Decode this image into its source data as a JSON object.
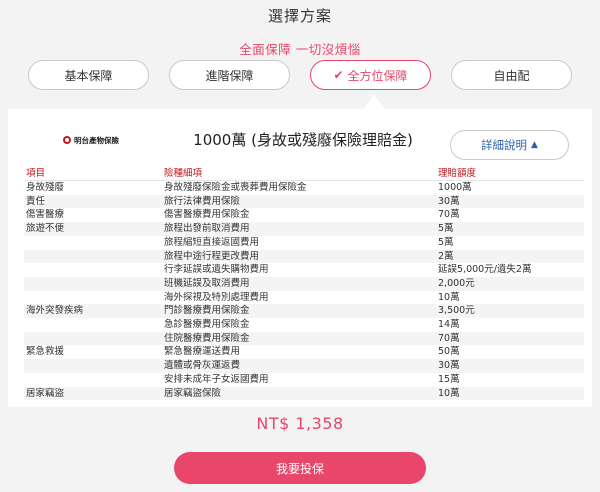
{
  "page": {
    "title": "選擇方案",
    "subtitle": "全面保障 一切沒煩惱"
  },
  "plans": [
    {
      "label": "基本保障",
      "active": false
    },
    {
      "label": "進階保障",
      "active": false
    },
    {
      "label": "全方位保障",
      "active": true
    },
    {
      "label": "自由配",
      "active": false
    }
  ],
  "insurer": {
    "logo_text": "明台產物保險"
  },
  "coverage": {
    "title": "1000萬 (身故或殘廢保險理賠金)",
    "details_label": "詳細說明",
    "headers": [
      "項目",
      "險種細項",
      "理賠額度"
    ],
    "rows": [
      [
        "身故殘廢",
        "身故殘廢保險金或喪葬費用保險金",
        "1000萬"
      ],
      [
        "責任",
        "旅行法律費用保險",
        "30萬"
      ],
      [
        "傷害醫療",
        "傷害醫療費用保險金",
        "70萬"
      ],
      [
        "旅遊不便",
        "旅程出發前取消費用",
        "5萬"
      ],
      [
        "",
        "旅程縮短直接返國費用",
        "5萬"
      ],
      [
        "",
        "旅程中途行程更改費用",
        "2萬"
      ],
      [
        "",
        "行李延誤或遺失購物費用",
        "延誤5,000元/遺失2萬"
      ],
      [
        "",
        "班機延誤及取消費用",
        "2,000元"
      ],
      [
        "",
        "海外探視及特別處理費用",
        "10萬"
      ],
      [
        "海外突發疾病",
        "門診醫療費用保險金",
        "3,500元"
      ],
      [
        "",
        "急診醫療費用保險金",
        "14萬"
      ],
      [
        "",
        "住院醫療費用保險金",
        "70萬"
      ],
      [
        "緊急救援",
        "緊急醫療運送費用",
        "50萬"
      ],
      [
        "",
        "遺體或骨灰運返費",
        "30萬"
      ],
      [
        "",
        "安排未成年子女返國費用",
        "15萬"
      ],
      [
        "居家竊盜",
        "居家竊盜保險",
        "10萬"
      ]
    ]
  },
  "price": "NT$ 1,358",
  "cta_label": "我要投保",
  "colors": {
    "accent": "#e8466a",
    "link": "#2b63ad",
    "header_red": "#c4161c"
  },
  "icons": {
    "active_plan": "check-icon",
    "details": "chevron-up-icon"
  }
}
